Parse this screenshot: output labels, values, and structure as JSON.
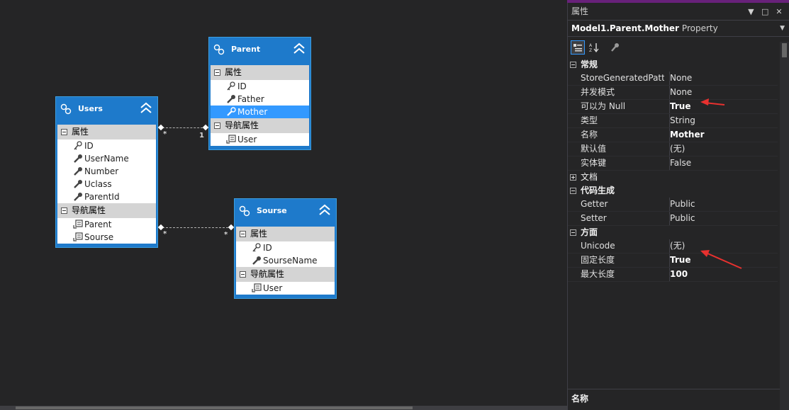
{
  "entities": {
    "users": {
      "title": "Users",
      "props_section": "属性",
      "props": [
        "ID",
        "UserName",
        "Number",
        "Uclass",
        "ParentId"
      ],
      "nav_section": "导航属性",
      "nav": [
        "Parent",
        "Sourse"
      ]
    },
    "parent": {
      "title": "Parent",
      "props_section": "属性",
      "props": [
        "ID",
        "Father",
        "Mother"
      ],
      "selected": "Mother",
      "nav_section": "导航属性",
      "nav": [
        "User"
      ]
    },
    "sourse": {
      "title": "Sourse",
      "props_section": "属性",
      "props": [
        "ID",
        "SourseName"
      ],
      "nav_section": "导航属性",
      "nav": [
        "User"
      ]
    }
  },
  "associations": {
    "users_parent": {
      "left": "*",
      "right": "1"
    },
    "users_sourse": {
      "left": "*",
      "right": "*"
    }
  },
  "properties_panel": {
    "title": "属性",
    "object_name": "Model1.Parent.Mother",
    "object_type": "Property",
    "categories": [
      {
        "name": "常规",
        "expanded": true,
        "rows": [
          {
            "name": "StoreGeneratedPattern",
            "value": "None",
            "bold": false
          },
          {
            "name": "并发模式",
            "value": "None",
            "bold": false
          },
          {
            "name": "可以为 Null",
            "value": "True",
            "bold": true
          },
          {
            "name": "类型",
            "value": "String",
            "bold": false
          },
          {
            "name": "名称",
            "value": "Mother",
            "bold": true
          },
          {
            "name": "默认值",
            "value": "(无)",
            "bold": false
          },
          {
            "name": "实体键",
            "value": "False",
            "bold": false
          }
        ]
      },
      {
        "name": "文档",
        "expanded": false,
        "rows": []
      },
      {
        "name": "代码生成",
        "expanded": true,
        "rows": [
          {
            "name": "Getter",
            "value": "Public",
            "bold": false
          },
          {
            "name": "Setter",
            "value": "Public",
            "bold": false
          }
        ]
      },
      {
        "name": "方面",
        "expanded": true,
        "rows": [
          {
            "name": "Unicode",
            "value": "(无)",
            "bold": false
          },
          {
            "name": "固定长度",
            "value": "True",
            "bold": true
          },
          {
            "name": "最大长度",
            "value": "100",
            "bold": true
          }
        ]
      }
    ],
    "description_title": "名称"
  },
  "colors": {
    "entity_header": "#1e7acb",
    "selection": "#3399ff",
    "annotation_arrow": "#e8312f",
    "title_accent": "#68217a"
  }
}
